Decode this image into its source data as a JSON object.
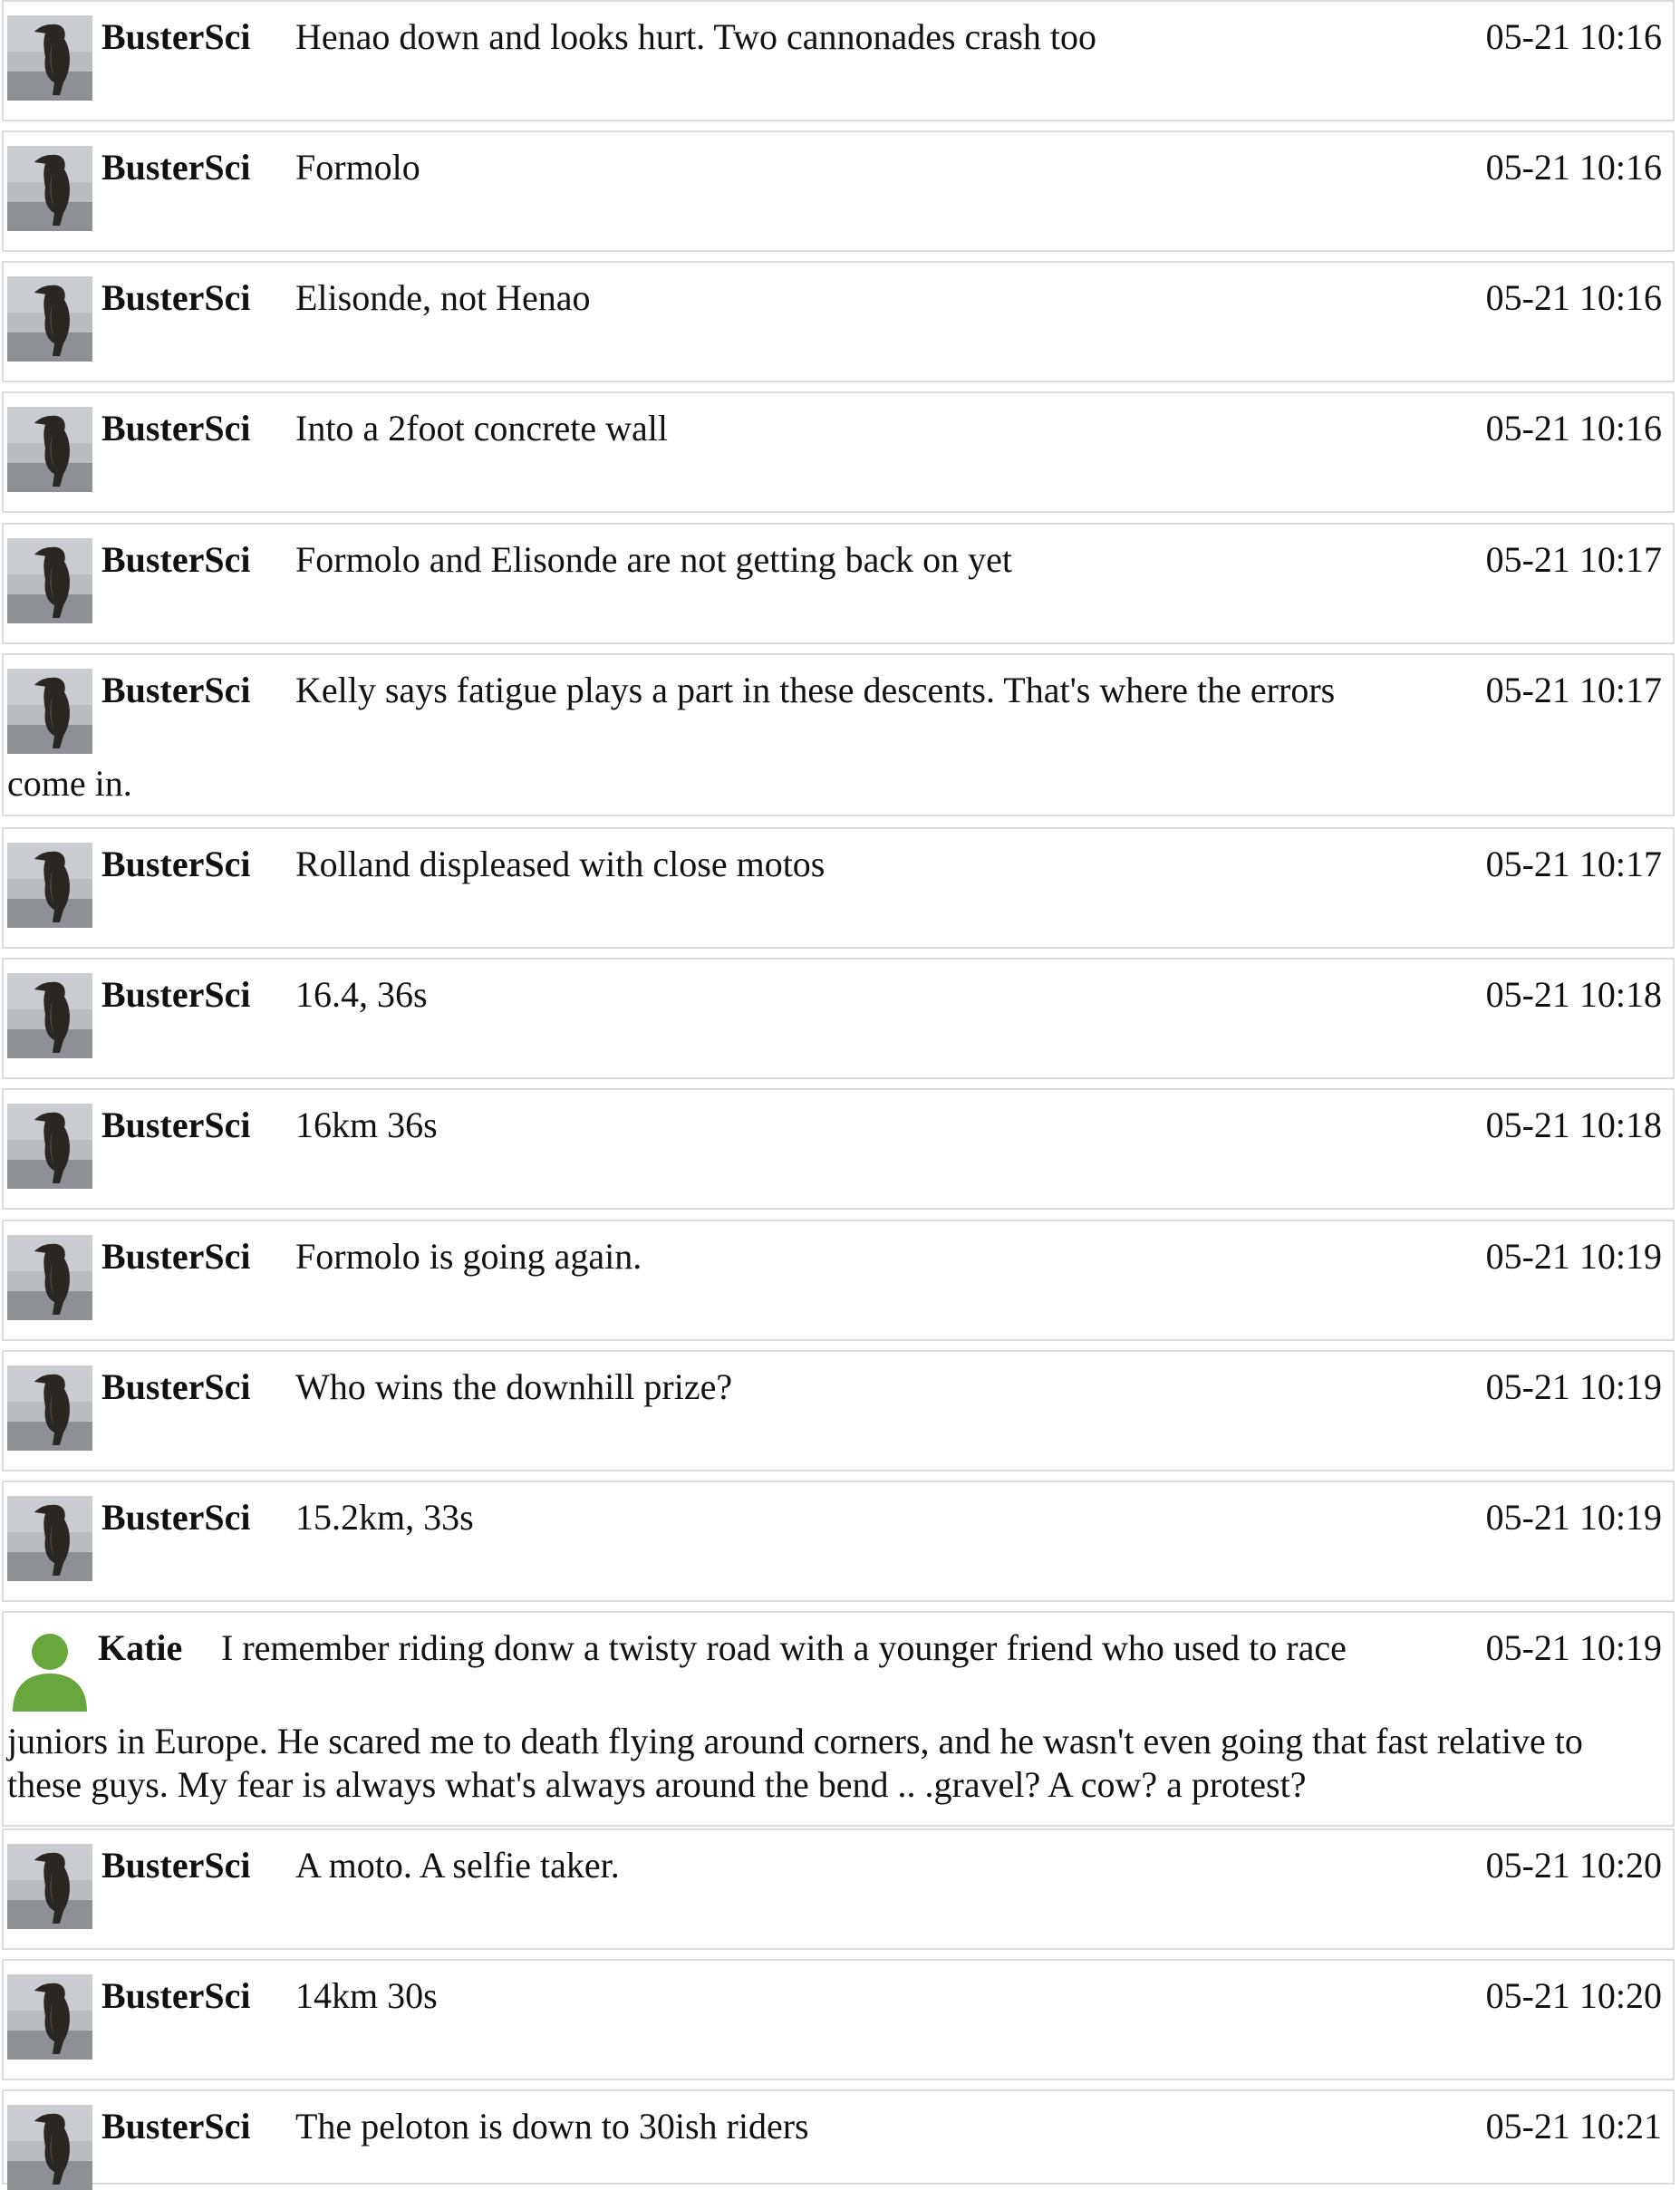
{
  "messages": [
    {
      "user": "BusterSci",
      "avatar": "penguin-avatar",
      "text": "Henao down and looks hurt. Two cannonades crash too",
      "continuation": "",
      "time": "05-21 10:16"
    },
    {
      "user": "BusterSci",
      "avatar": "penguin-avatar",
      "text": "Formolo",
      "continuation": "",
      "time": "05-21 10:16"
    },
    {
      "user": "BusterSci",
      "avatar": "penguin-avatar",
      "text": "Elisonde, not Henao",
      "continuation": "",
      "time": "05-21 10:16"
    },
    {
      "user": "BusterSci",
      "avatar": "penguin-avatar",
      "text": "Into a 2foot concrete wall",
      "continuation": "",
      "time": "05-21 10:16"
    },
    {
      "user": "BusterSci",
      "avatar": "penguin-avatar",
      "text": "Formolo and Elisonde are not getting back on yet",
      "continuation": "",
      "time": "05-21 10:17"
    },
    {
      "user": "BusterSci",
      "avatar": "penguin-avatar",
      "text": "Kelly says fatigue plays a part in these descents. That's where the errors",
      "continuation": "come in.",
      "time": "05-21 10:17"
    },
    {
      "user": "BusterSci",
      "avatar": "penguin-avatar",
      "text": "Rolland displeased with close motos",
      "continuation": "",
      "time": "05-21 10:17"
    },
    {
      "user": "BusterSci",
      "avatar": "penguin-avatar",
      "text": "16.4, 36s",
      "continuation": "",
      "time": "05-21 10:18"
    },
    {
      "user": "BusterSci",
      "avatar": "penguin-avatar",
      "text": "16km 36s",
      "continuation": "",
      "time": "05-21 10:18"
    },
    {
      "user": "BusterSci",
      "avatar": "penguin-avatar",
      "text": "Formolo is going again.",
      "continuation": "",
      "time": "05-21 10:19"
    },
    {
      "user": "BusterSci",
      "avatar": "penguin-avatar",
      "text": "Who wins the downhill prize?",
      "continuation": "",
      "time": "05-21 10:19"
    },
    {
      "user": "BusterSci",
      "avatar": "penguin-avatar",
      "text": "15.2km, 33s",
      "continuation": "",
      "time": "05-21 10:19"
    },
    {
      "user": "Katie",
      "avatar": "default-user-avatar",
      "text": "I remember riding donw a twisty road with a younger friend who used to race",
      "continuation": "juniors in Europe. He scared me to death flying around corners, and he wasn't even going that fast relative to these guys. My fear is always what's always around the bend .. .gravel? A cow? a protest?",
      "time": "05-21 10:19"
    },
    {
      "user": "BusterSci",
      "avatar": "penguin-avatar",
      "text": "A moto. A selfie taker.",
      "continuation": "",
      "time": "05-21 10:20"
    },
    {
      "user": "BusterSci",
      "avatar": "penguin-avatar",
      "text": "14km 30s",
      "continuation": "",
      "time": "05-21 10:20"
    },
    {
      "user": "BusterSci",
      "avatar": "penguin-avatar",
      "text": "The peloton is down to 30ish riders",
      "continuation": "",
      "time": "05-21 10:21"
    }
  ]
}
